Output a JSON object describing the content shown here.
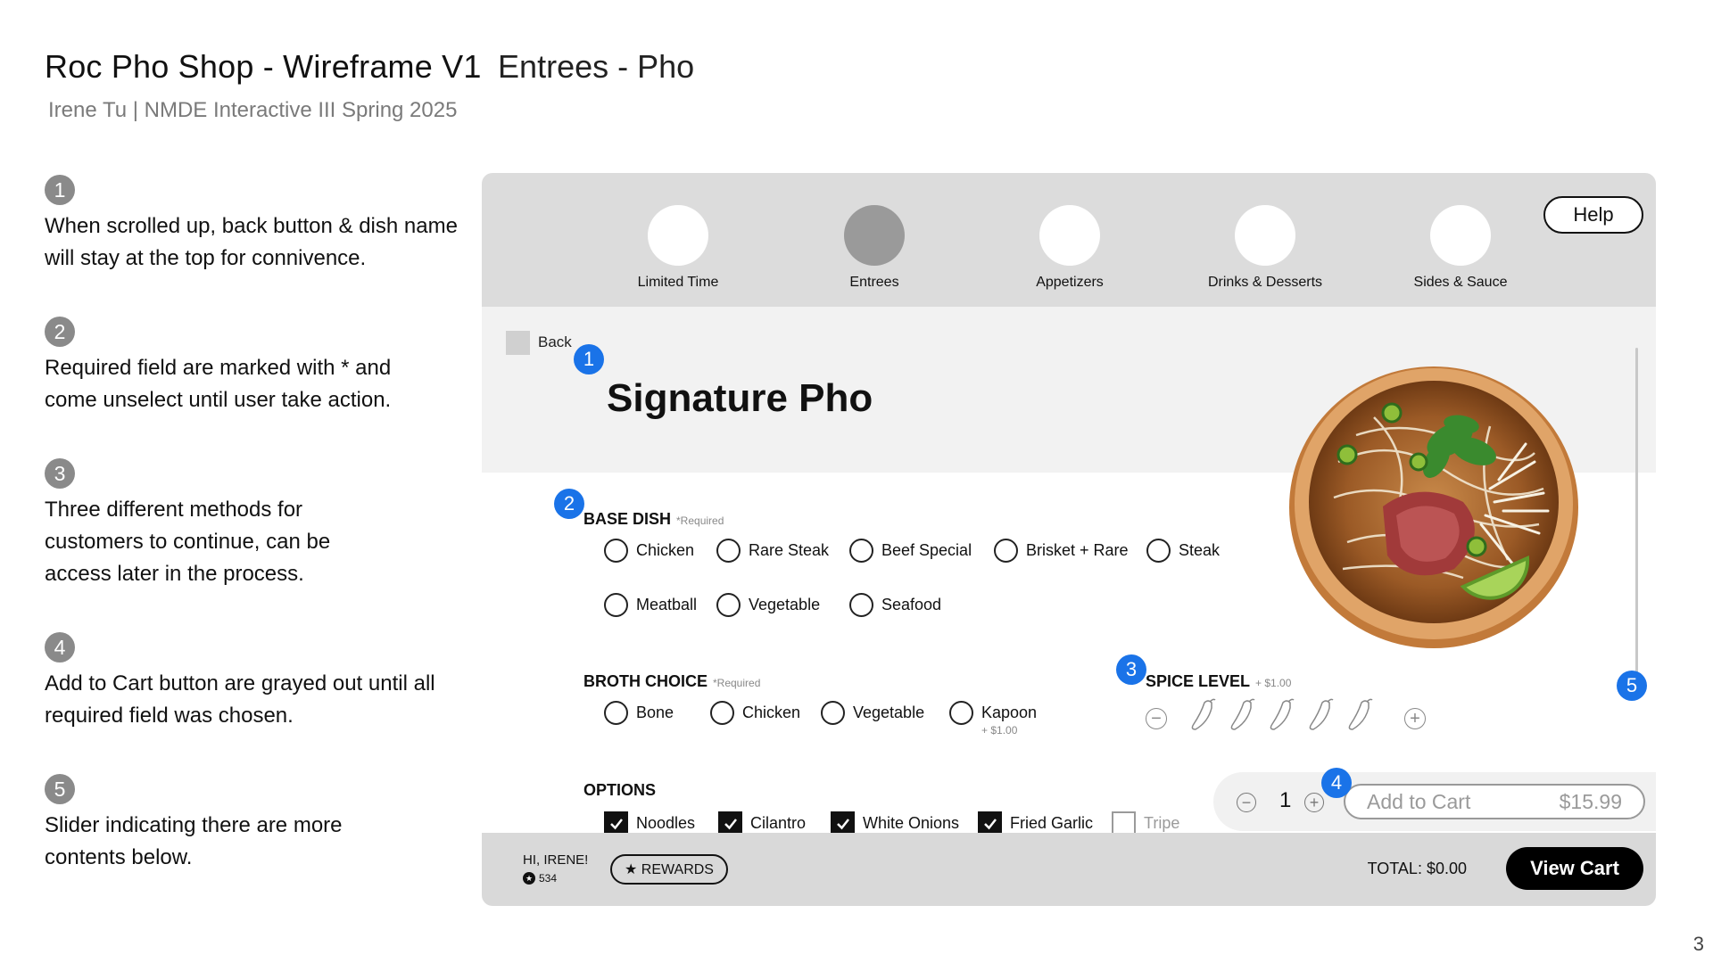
{
  "slide": {
    "title": "Roc Pho Shop - Wireframe V1",
    "title_sub": "Entrees - Pho",
    "subtitle": "Irene Tu | NMDE Interactive III Spring 2025",
    "page_number": "3"
  },
  "notes": [
    {
      "num": "1",
      "text": "When scrolled up, back button & dish name will stay at the top for connivence."
    },
    {
      "num": "2",
      "text": "Required field are marked with * and come unselect until user take action."
    },
    {
      "num": "3",
      "text": "Three different methods for customers to continue, can be access later in the process."
    },
    {
      "num": "4",
      "text": "Add to Cart button are grayed out until all required field was chosen."
    },
    {
      "num": "5",
      "text": "Slider indicating there are more contents below."
    }
  ],
  "mockup": {
    "categories": [
      {
        "label": "Limited Time",
        "active": false
      },
      {
        "label": "Entrees",
        "active": true
      },
      {
        "label": "Appetizers",
        "active": false
      },
      {
        "label": "Drinks & Desserts",
        "active": false
      },
      {
        "label": "Sides & Sauce",
        "active": false
      }
    ],
    "help_label": "Help",
    "back_label": "Back",
    "dish_title": "Signature Pho",
    "badges": [
      "1",
      "2",
      "3",
      "4",
      "5"
    ],
    "base_dish": {
      "label": "BASE DISH",
      "required": "*Required",
      "options": [
        "Chicken",
        "Rare Steak",
        "Beef Special",
        "Brisket + Rare",
        "Steak",
        "Meatball",
        "Vegetable",
        "Seafood"
      ]
    },
    "broth": {
      "label": "BROTH CHOICE",
      "required": "*Required",
      "options": [
        "Bone",
        "Chicken",
        "Vegetable",
        "Kapoon"
      ],
      "kapoon_price": "+ $1.00"
    },
    "spice": {
      "label": "SPICE LEVEL",
      "price": "+ $1.00",
      "minus": "−",
      "plus": "+",
      "peppers": 5
    },
    "options_section": {
      "label": "OPTIONS",
      "items": [
        {
          "label": "Noodles",
          "checked": true
        },
        {
          "label": "Cilantro",
          "checked": true
        },
        {
          "label": "White Onions",
          "checked": true
        },
        {
          "label": "Fried Garlic",
          "checked": true
        },
        {
          "label": "Tripe",
          "checked": false
        }
      ]
    },
    "cart": {
      "minus": "−",
      "plus": "+",
      "quantity": "1",
      "add_label": "Add to Cart",
      "price": "$15.99"
    },
    "footer": {
      "greeting": "HI, IRENE!",
      "points": "534",
      "rewards_label": "★ REWARDS",
      "total": "TOTAL: $0.00",
      "view_cart": "View Cart"
    },
    "colors": {
      "badge": "#1a73e8",
      "category_bar": "#dcdcdc",
      "header_bg": "#f2f2f2",
      "footer_bg": "#d9d9d9",
      "cta": "#000000"
    }
  }
}
